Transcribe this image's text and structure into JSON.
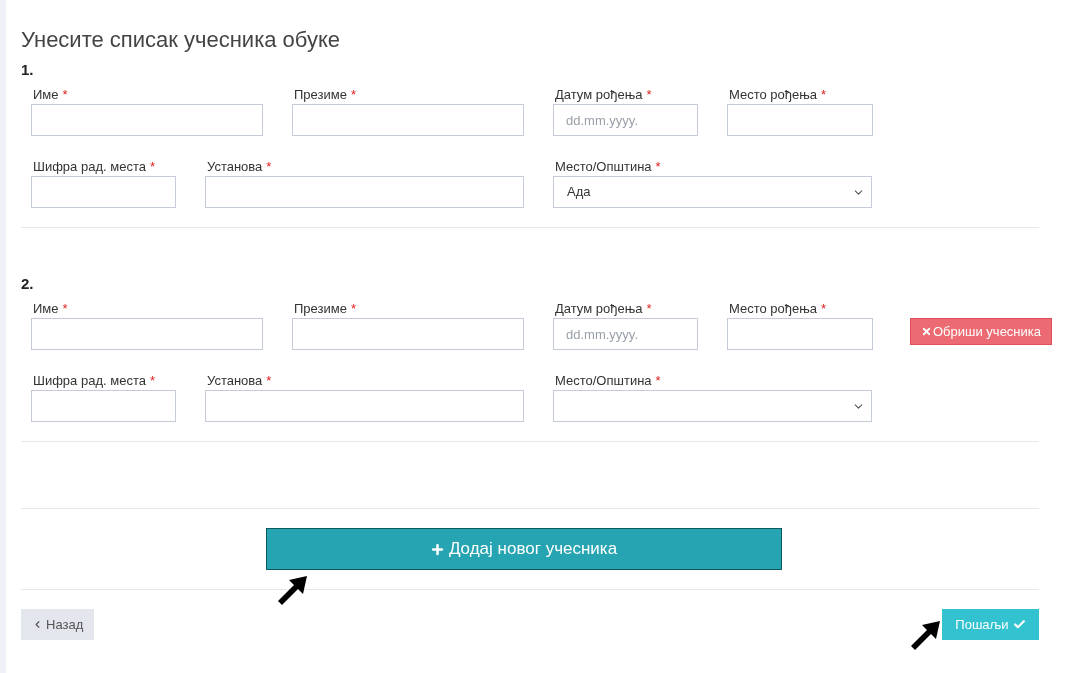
{
  "title": "Унесите списак учесника обуке",
  "participants": [
    {
      "number": "1.",
      "rows": [
        [
          {
            "label": "Име",
            "required_mark": "*",
            "kind": "text"
          },
          {
            "label": "Презиме",
            "required_mark": "*",
            "kind": "text"
          },
          {
            "label": "Датум рођења",
            "required_mark": "*",
            "kind": "date",
            "placeholder": "dd.mm.yyyy."
          },
          {
            "label": "Место рођења",
            "required_mark": "*",
            "kind": "text"
          }
        ],
        [
          {
            "label": "Шифра рад. места",
            "required_mark": "*",
            "kind": "text"
          },
          {
            "label": "Установа",
            "required_mark": "*",
            "kind": "text"
          },
          {
            "label": "Место/Општина",
            "required_mark": "*",
            "kind": "select",
            "value": "Ада"
          }
        ]
      ]
    },
    {
      "number": "2.",
      "delete_button": "Обриши учесника",
      "rows": [
        [
          {
            "label": "Име",
            "required_mark": "*",
            "kind": "text"
          },
          {
            "label": "Презиме",
            "required_mark": "*",
            "kind": "text"
          },
          {
            "label": "Датум рођења",
            "required_mark": "*",
            "kind": "date",
            "placeholder": "dd.mm.yyyy."
          },
          {
            "label": "Место рођења",
            "required_mark": "*",
            "kind": "text"
          }
        ],
        [
          {
            "label": "Шифра рад. места",
            "required_mark": "*",
            "kind": "text"
          },
          {
            "label": "Установа",
            "required_mark": "*",
            "kind": "text"
          },
          {
            "label": "Место/Општина",
            "required_mark": "*",
            "kind": "select"
          }
        ]
      ]
    }
  ],
  "add_button": "Додај новог учесника",
  "back_button": "Назад",
  "submit_button": "Пошаљи"
}
